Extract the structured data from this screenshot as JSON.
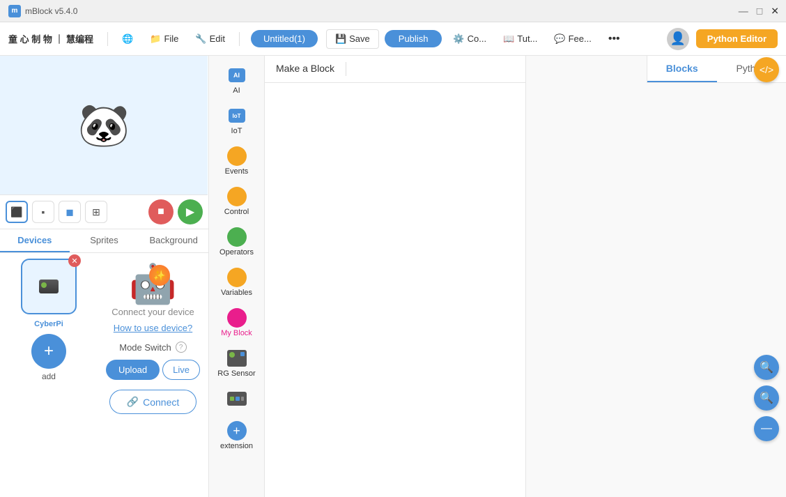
{
  "titleBar": {
    "appName": "mBlock v5.4.0",
    "controls": {
      "minimize": "—",
      "maximize": "□",
      "close": "✕"
    }
  },
  "menuBar": {
    "brand": "童 心 制 物 ｜ 慧编程",
    "globeIcon": "🌐",
    "fileLabel": "File",
    "editLabel": "Edit",
    "projectName": "Untitled(1)",
    "saveLabel": "Save",
    "publishLabel": "Publish",
    "connectLabel": "Co...",
    "tutorialLabel": "Tut...",
    "feedbackLabel": "Fee...",
    "moreLabel": "•••",
    "pythonEditorLabel": "Python Editor"
  },
  "leftPanel": {
    "tabs": [
      {
        "id": "devices",
        "label": "Devices"
      },
      {
        "id": "sprites",
        "label": "Sprites"
      },
      {
        "id": "background",
        "label": "Background"
      }
    ],
    "activeTab": "devices",
    "device": {
      "name": "CyberPi",
      "addLabel": "add"
    },
    "devicePanel": {
      "connectText": "Connect your device",
      "howToLabel": "How to use device?",
      "modeSwitchLabel": "Mode Switch",
      "uploadLabel": "Upload",
      "liveLabel": "Live",
      "connectBtnLabel": "Connect"
    }
  },
  "categories": [
    {
      "id": "ai",
      "label": "AI",
      "type": "icon",
      "color": "#4a90d9"
    },
    {
      "id": "iot",
      "label": "IoT",
      "type": "icon",
      "color": "#4a90d9"
    },
    {
      "id": "events",
      "label": "Events",
      "type": "dot",
      "color": "#f5a623"
    },
    {
      "id": "control",
      "label": "Control",
      "type": "dot",
      "color": "#f5a623"
    },
    {
      "id": "operators",
      "label": "Operators",
      "type": "dot",
      "color": "#4CAF50"
    },
    {
      "id": "variables",
      "label": "Variables",
      "type": "dot",
      "color": "#f5a623"
    },
    {
      "id": "myblock",
      "label": "My Block",
      "type": "dot",
      "color": "#e91e8c"
    },
    {
      "id": "rgsensor",
      "label": "RG Sensor",
      "type": "icon",
      "color": "#4a90d9"
    },
    {
      "id": "device2",
      "label": "",
      "type": "device-icon",
      "color": "#555"
    },
    {
      "id": "extension",
      "label": "extension",
      "type": "add",
      "color": "#4a90d9"
    }
  ],
  "blocksArea": {
    "makeBlockTab": "Make a Block",
    "blocksTab": "Blocks",
    "pythonTab": "Python"
  },
  "workspace": {
    "zoomInLabel": "🔍+",
    "zoomOutLabel": "🔍-",
    "resetLabel": "="
  },
  "codeToggle": {
    "icon": "</>"
  }
}
